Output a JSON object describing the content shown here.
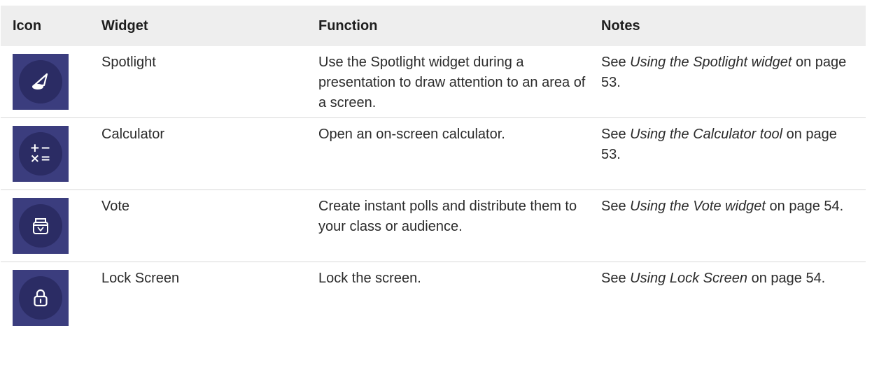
{
  "columns": {
    "icon": "Icon",
    "widget": "Widget",
    "function": "Function",
    "notes": "Notes"
  },
  "rows": [
    {
      "icon": "spotlight-icon",
      "widget": "Spotlight",
      "function": "Use the Spotlight widget during a presentation to draw attention to an area of a screen.",
      "notes_prefix": "See ",
      "notes_link": "Using the Spotlight widget",
      "notes_suffix": " on page 53."
    },
    {
      "icon": "calculator-icon",
      "icon_glyph_top": "+−",
      "icon_glyph_bottom": "×=",
      "widget": "Calculator",
      "function": "Open an on-screen calculator.",
      "notes_prefix": "See ",
      "notes_link": "Using the Calculator tool",
      "notes_suffix": " on page 53."
    },
    {
      "icon": "vote-icon",
      "widget": "Vote",
      "function": "Create instant polls and distribute them to your class or audience.",
      "notes_prefix": "See ",
      "notes_link": "Using the Vote widget",
      "notes_suffix": " on page 54."
    },
    {
      "icon": "lock-icon",
      "widget": "Lock Screen",
      "function": "Lock the screen.",
      "notes_prefix": "See ",
      "notes_link": "Using Lock Screen",
      "notes_suffix": " on page 54."
    }
  ],
  "colors": {
    "tile": "#3b3d7e",
    "circle": "#2b2c64",
    "header_bg": "#eeeeee"
  }
}
